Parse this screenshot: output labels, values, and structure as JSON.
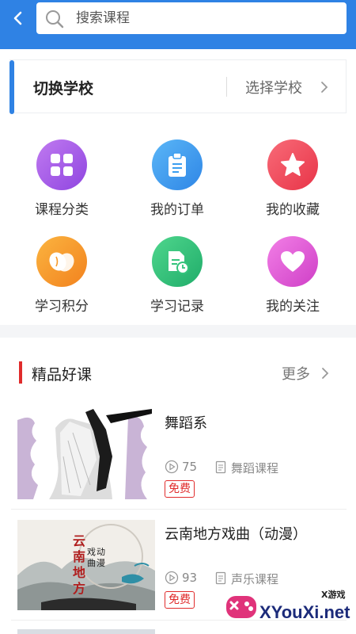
{
  "header": {
    "search_placeholder": "搜索课程"
  },
  "school": {
    "title": "切换学校",
    "action": "选择学校"
  },
  "menu": [
    {
      "label": "课程分类",
      "icon": "grid-icon",
      "color": "#a55ae8"
    },
    {
      "label": "我的订单",
      "icon": "clipboard-icon",
      "color": "#3b9ef0"
    },
    {
      "label": "我的收藏",
      "icon": "star-icon",
      "color": "#f04a5a"
    },
    {
      "label": "学习积分",
      "icon": "bean-icon",
      "color": "#f79a2a"
    },
    {
      "label": "学习记录",
      "icon": "record-icon",
      "color": "#34c47c"
    },
    {
      "label": "我的关注",
      "icon": "heart-icon",
      "color": "#e35bd6"
    }
  ],
  "featured": {
    "title": "精品好课",
    "more": "更多",
    "courses": [
      {
        "name": "舞蹈系",
        "views": "75",
        "category": "舞蹈课程",
        "tag": "免费"
      },
      {
        "name": "云南地方戏曲（动漫）",
        "views": "93",
        "category": "声乐课程",
        "tag": "免费"
      }
    ]
  },
  "watermark": {
    "brand": "XYouXi.net",
    "small": "X游戏"
  }
}
